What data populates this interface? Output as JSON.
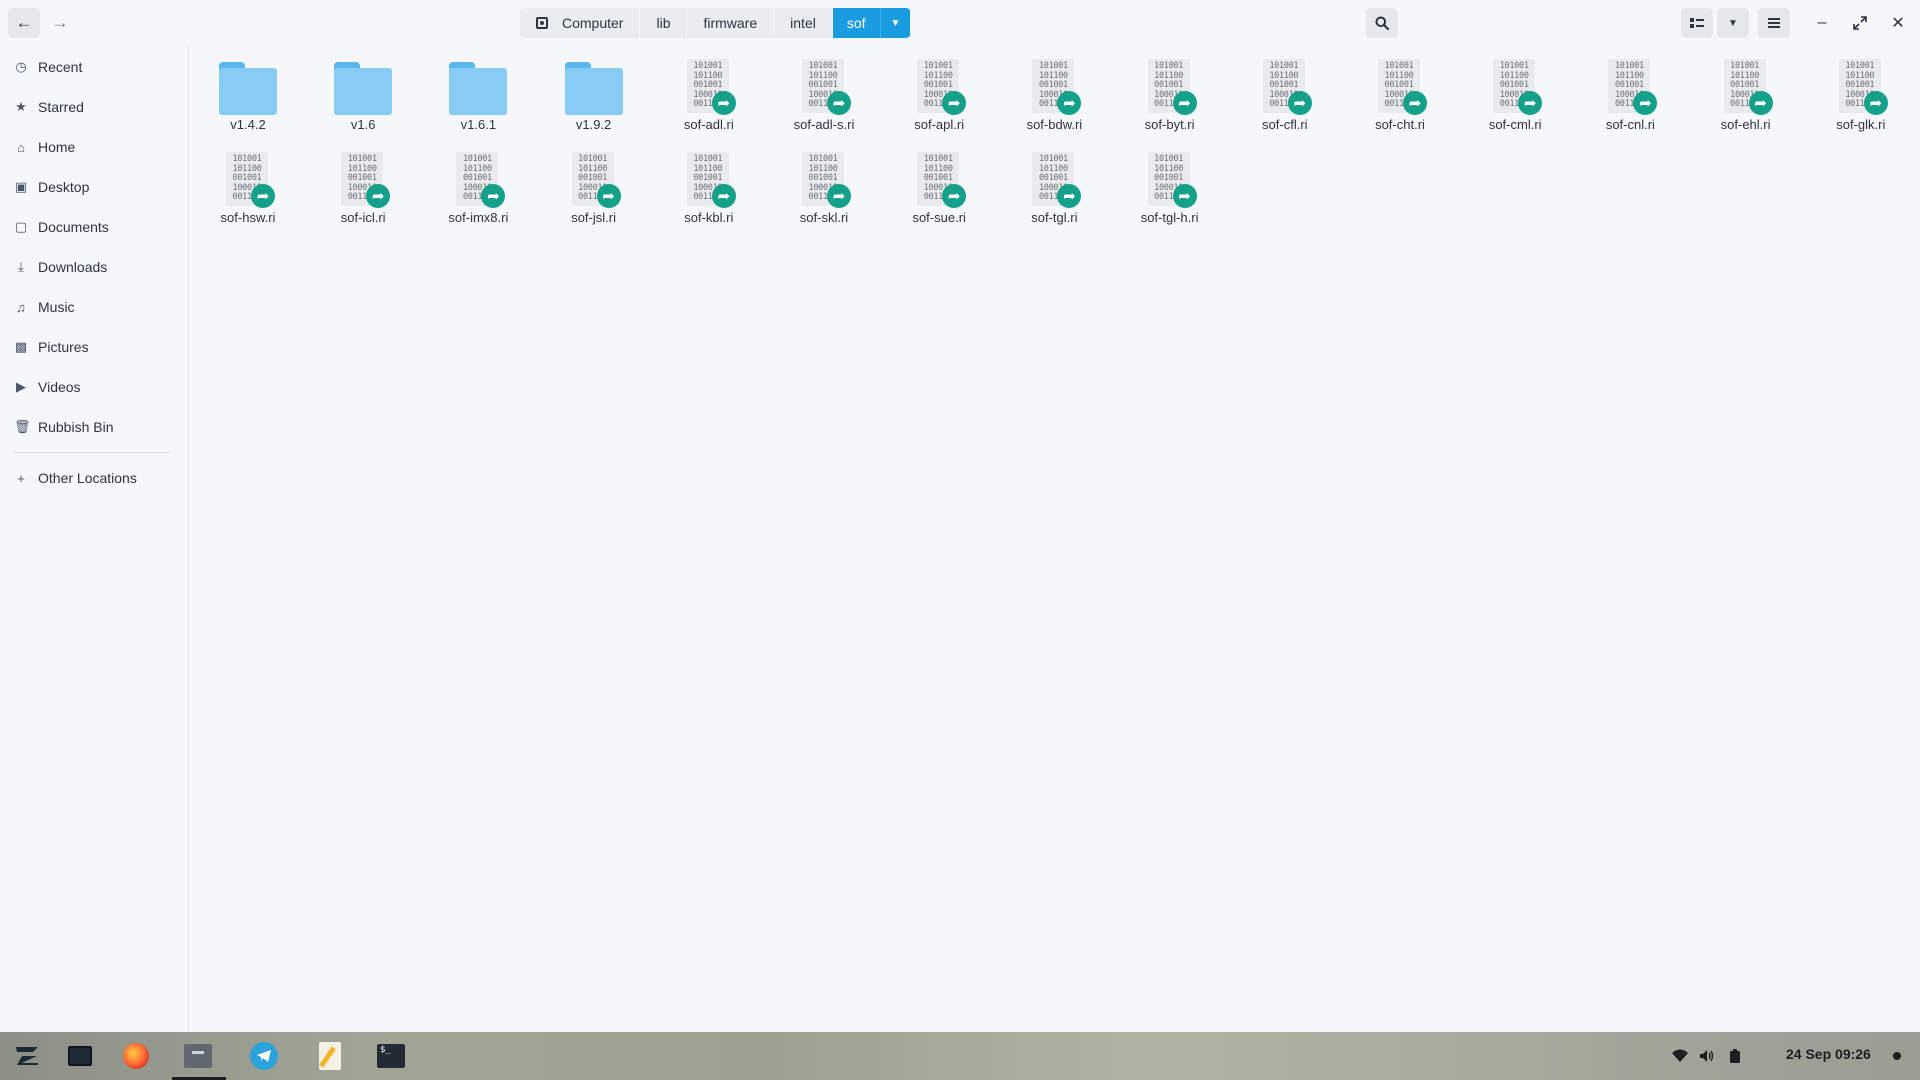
{
  "header": {
    "breadcrumb": [
      "Computer",
      "lib",
      "firmware",
      "intel",
      "sof"
    ],
    "back_icon": "arrow-left-icon",
    "forward_icon": "arrow-right-icon",
    "search_icon": "search-icon",
    "view_icon": "grid-view-icon",
    "menu_icon": "hamburger-menu-icon"
  },
  "sidebar": {
    "items": [
      {
        "label": "Recent",
        "icon": "clock-icon"
      },
      {
        "label": "Starred",
        "icon": "star-icon"
      },
      {
        "label": "Home",
        "icon": "home-icon"
      },
      {
        "label": "Desktop",
        "icon": "desktop-icon"
      },
      {
        "label": "Documents",
        "icon": "document-icon"
      },
      {
        "label": "Downloads",
        "icon": "download-icon"
      },
      {
        "label": "Music",
        "icon": "music-icon"
      },
      {
        "label": "Pictures",
        "icon": "picture-icon"
      },
      {
        "label": "Videos",
        "icon": "video-icon"
      },
      {
        "label": "Rubbish Bin",
        "icon": "trash-icon"
      }
    ],
    "other_locations": "Other Locations"
  },
  "files": [
    {
      "name": "v1.4.2",
      "type": "folder"
    },
    {
      "name": "v1.6",
      "type": "folder"
    },
    {
      "name": "v1.6.1",
      "type": "folder"
    },
    {
      "name": "v1.9.2",
      "type": "folder"
    },
    {
      "name": "sof-adl.ri",
      "type": "binary-link"
    },
    {
      "name": "sof-adl-s.ri",
      "type": "binary-link"
    },
    {
      "name": "sof-apl.ri",
      "type": "binary-link"
    },
    {
      "name": "sof-bdw.ri",
      "type": "binary-link"
    },
    {
      "name": "sof-byt.ri",
      "type": "binary-link"
    },
    {
      "name": "sof-cfl.ri",
      "type": "binary-link"
    },
    {
      "name": "sof-cht.ri",
      "type": "binary-link"
    },
    {
      "name": "sof-cml.ri",
      "type": "binary-link"
    },
    {
      "name": "sof-cnl.ri",
      "type": "binary-link"
    },
    {
      "name": "sof-ehl.ri",
      "type": "binary-link"
    },
    {
      "name": "sof-glk.ri",
      "type": "binary-link"
    },
    {
      "name": "sof-hsw.ri",
      "type": "binary-link"
    },
    {
      "name": "sof-icl.ri",
      "type": "binary-link"
    },
    {
      "name": "sof-imx8.ri",
      "type": "binary-link"
    },
    {
      "name": "sof-jsl.ri",
      "type": "binary-link"
    },
    {
      "name": "sof-kbl.ri",
      "type": "binary-link"
    },
    {
      "name": "sof-skl.ri",
      "type": "binary-link"
    },
    {
      "name": "sof-sue.ri",
      "type": "binary-link"
    },
    {
      "name": "sof-tgl.ri",
      "type": "binary-link"
    },
    {
      "name": "sof-tgl-h.ri",
      "type": "binary-link"
    }
  ],
  "taskbar": {
    "apps": [
      "zorin-menu-icon",
      "workspaces-icon",
      "firefox-icon",
      "files-icon",
      "telegram-icon",
      "text-editor-icon",
      "terminal-icon"
    ],
    "tray": [
      "wifi-icon",
      "volume-icon",
      "battery-icon"
    ],
    "clock": "24 Sep  09:26"
  },
  "colors": {
    "accent": "#1a9ce0",
    "folder": "#86ccf5",
    "link_badge": "#15a08a"
  }
}
